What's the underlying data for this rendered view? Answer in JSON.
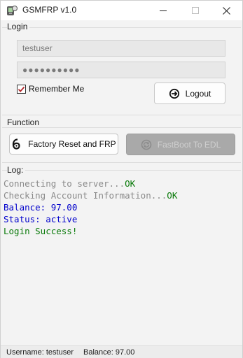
{
  "window": {
    "title": "GSMFRP v1.0"
  },
  "login": {
    "group_label": "Login",
    "username_value": "testuser",
    "password_value": "●●●●●●●●●●",
    "remember_label": "Remember Me",
    "remember_checked": true,
    "logout_label": "Logout"
  },
  "function": {
    "group_label": "Function",
    "factory_reset_label": "Factory Reset and FRP",
    "fastboot_label": "FastBoot To EDL"
  },
  "log": {
    "group_label": "Log:",
    "lines": [
      {
        "prefix": "Connecting to server...",
        "suffix": "OK",
        "prefix_color": "#8a8a8a",
        "suffix_color": "#0a7a0a"
      },
      {
        "prefix": "Checking Account Information...",
        "suffix": "OK",
        "prefix_color": "#8a8a8a",
        "suffix_color": "#0a7a0a"
      },
      {
        "prefix": "Balance: 97.00",
        "suffix": "",
        "prefix_color": "#0000cc",
        "suffix_color": "#0000cc"
      },
      {
        "prefix": "Status: active",
        "suffix": "",
        "prefix_color": "#0000cc",
        "suffix_color": "#0000cc"
      },
      {
        "prefix": "Login Success!",
        "suffix": "",
        "prefix_color": "#0a7a0a",
        "suffix_color": "#0a7a0a"
      }
    ]
  },
  "statusbar": {
    "username_text": "Username: testuser",
    "balance_text": "Balance: 97.00"
  },
  "icons": {
    "app": "gsm-app-icon",
    "logout": "logout-icon",
    "factory_reset": "factory-reset-icon",
    "fastboot": "fastboot-icon"
  }
}
